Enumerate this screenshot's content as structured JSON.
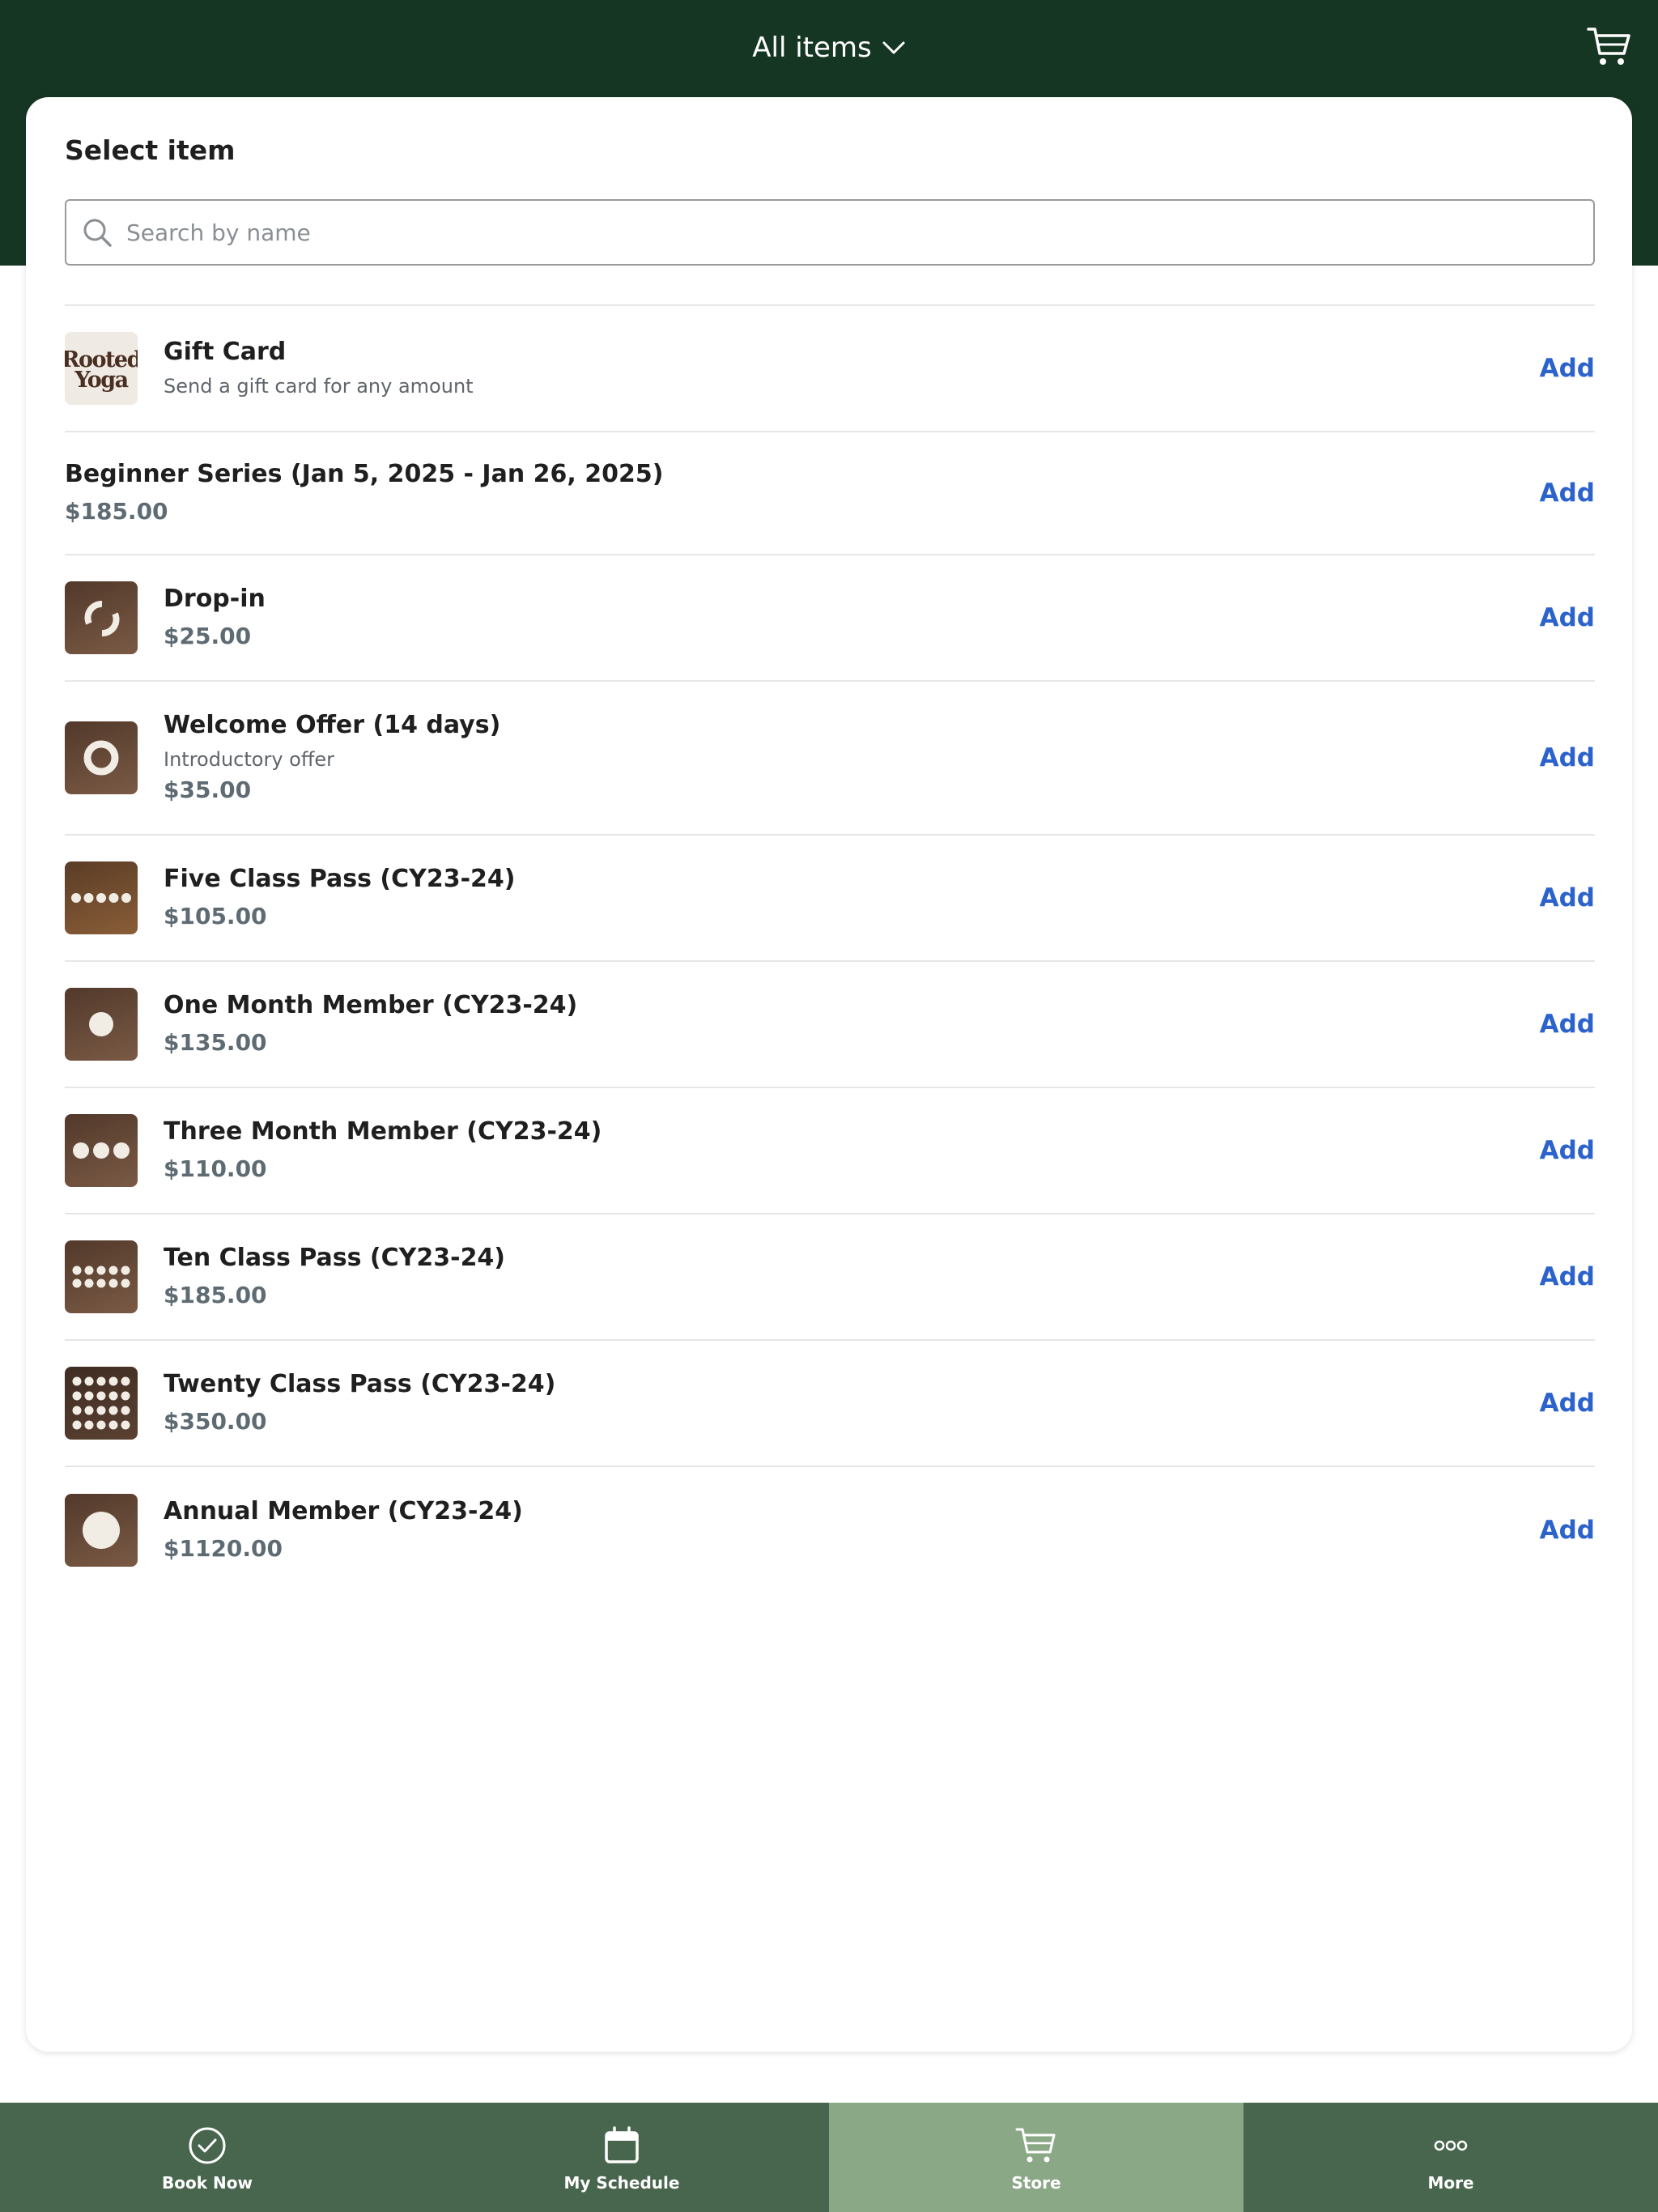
{
  "header": {
    "title": "All items",
    "cart_icon": "cart-icon",
    "bg_color": "#163624"
  },
  "panel": {
    "title": "Select item",
    "search": {
      "placeholder": "Search by name",
      "value": ""
    }
  },
  "items": [
    {
      "name": "Gift Card",
      "description": "Send a gift card for any amount",
      "price": "",
      "thumb": "rooted-yoga-logo",
      "logo_text_1": "Rooted",
      "logo_text_2": "Yoga",
      "add_label": "Add"
    },
    {
      "name": "Beginner Series (Jan 5, 2025 - Jan 26, 2025)",
      "description": "",
      "price": "$185.00",
      "thumb": "",
      "add_label": "Add"
    },
    {
      "name": "Drop-in",
      "description": "",
      "price": "$25.00",
      "thumb": "broken-circle-icon",
      "add_label": "Add"
    },
    {
      "name": "Welcome Offer (14 days)",
      "description": "Introductory offer",
      "price": "$35.00",
      "thumb": "ring-icon",
      "add_label": "Add"
    },
    {
      "name": "Five Class Pass (CY23-24)",
      "description": "",
      "price": "$105.00",
      "thumb": "five-dots-icon",
      "add_label": "Add"
    },
    {
      "name": "One Month Member (CY23-24)",
      "description": "",
      "price": "$135.00",
      "thumb": "one-dot-icon",
      "add_label": "Add"
    },
    {
      "name": "Three Month Member (CY23-24)",
      "description": "",
      "price": "$110.00",
      "thumb": "three-dots-icon",
      "add_label": "Add"
    },
    {
      "name": "Ten Class Pass (CY23-24)",
      "description": "",
      "price": "$185.00",
      "thumb": "ten-dots-icon",
      "add_label": "Add"
    },
    {
      "name": "Twenty Class Pass (CY23-24)",
      "description": "",
      "price": "$350.00",
      "thumb": "twenty-dots-icon",
      "add_label": "Add"
    },
    {
      "name": "Annual Member (CY23-24)",
      "description": "",
      "price": "$1120.00",
      "thumb": "large-dot-icon",
      "add_label": "Add"
    }
  ],
  "tabbar": {
    "tabs": [
      {
        "label": "Book Now",
        "icon": "check-circle-icon",
        "active": false
      },
      {
        "label": "My Schedule",
        "icon": "calendar-icon",
        "active": false
      },
      {
        "label": "Store",
        "icon": "cart-icon",
        "active": true
      },
      {
        "label": "More",
        "icon": "more-dots-icon",
        "active": false
      }
    ],
    "bg_color": "#48664d",
    "active_color": "#8aa886"
  },
  "colors": {
    "accent": "#2b62cc"
  }
}
